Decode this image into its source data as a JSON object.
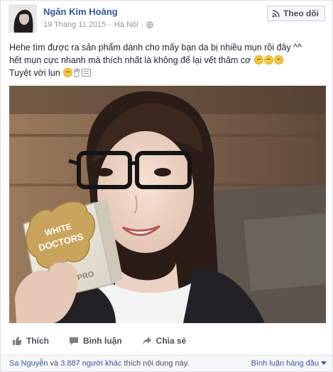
{
  "post": {
    "author": "Ngân Kim Hoàng",
    "date": "19 Tháng 11 2015",
    "separator": "·",
    "location": "Hà Nội",
    "follow_label": "Theo dõi",
    "caption_line1": "Hehe tìm được ra sản phẩm dành cho mấy bạn da bị nhiều mụn rồi đây ^^",
    "caption_line2": "hết mụn cực nhanh mà thích nhất là không để lại vết thâm cơ",
    "caption_line3": "Tuyệt vời lun",
    "photo_product_text": {
      "brand_line1": "WHITE",
      "brand_line2": "DOCTORS",
      "product": "ACNE PRO"
    }
  },
  "actions": {
    "like": "Thích",
    "comment": "Bình luận",
    "share": "Chia sẻ"
  },
  "footer": {
    "liker_name": "Sa Nguyễn",
    "conjunction": "và",
    "others_count": "3.887 người khác",
    "liked_suffix": "thích nội dung này.",
    "sort_label": "Bình luận hàng đầu"
  },
  "colors": {
    "link": "#365899",
    "text": "#1d2129",
    "muted": "#90949c"
  },
  "icons": [
    "globe-icon",
    "rss-icon",
    "like-icon",
    "comment-icon",
    "share-icon",
    "caret-down-icon"
  ]
}
